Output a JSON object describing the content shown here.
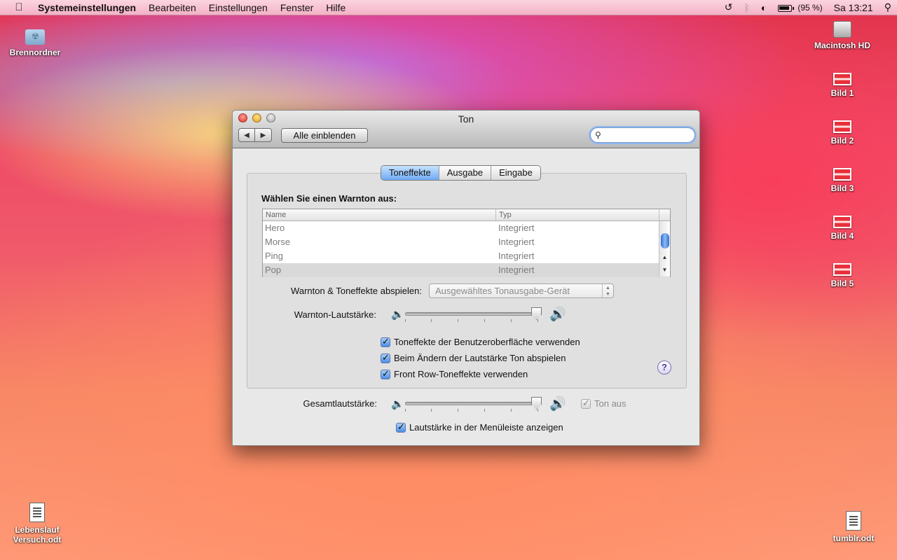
{
  "menubar": {
    "apple_icon": "apple-icon",
    "app_name": "Systemeinstellungen",
    "menus": [
      "Bearbeiten",
      "Einstellungen",
      "Fenster",
      "Hilfe"
    ],
    "battery_percent": "(95 %)",
    "clock": "Sa 13:21"
  },
  "desktop": {
    "icons": [
      {
        "label": "Brennordner",
        "icon": "burn-folder-icon"
      },
      {
        "label": "Macintosh HD",
        "icon": "hard-drive-icon"
      },
      {
        "label": "Bild 1",
        "icon": "image-file-icon"
      },
      {
        "label": "Bild 2",
        "icon": "image-file-icon"
      },
      {
        "label": "Bild 3",
        "icon": "image-file-icon"
      },
      {
        "label": "Bild 4",
        "icon": "image-file-icon"
      },
      {
        "label": "Bild 5",
        "icon": "image-file-icon"
      },
      {
        "label": "Lebenslauf\nVersuch.odt",
        "icon": "document-icon"
      },
      {
        "label": "tumblr.odt",
        "icon": "document-icon"
      }
    ]
  },
  "window": {
    "title": "Ton",
    "show_all_label": "Alle einblenden",
    "search_value": "",
    "tabs": [
      {
        "label": "Toneffekte",
        "active": true
      },
      {
        "label": "Ausgabe",
        "active": false
      },
      {
        "label": "Eingabe",
        "active": false
      }
    ],
    "choose_label": "Wählen Sie einen Warnton aus:",
    "table": {
      "columns": [
        "Name",
        "Typ"
      ],
      "rows": [
        {
          "name": "Hero",
          "type": "Integriert",
          "selected": false
        },
        {
          "name": "Morse",
          "type": "Integriert",
          "selected": false
        },
        {
          "name": "Ping",
          "type": "Integriert",
          "selected": false
        },
        {
          "name": "Pop",
          "type": "Integriert",
          "selected": true
        }
      ]
    },
    "play_through_label": "Warnton & Toneffekte abspielen:",
    "play_through_value": "Ausgewähltes Tonausgabe-Gerät",
    "alert_volume_label": "Warnton-Lautstärke:",
    "alert_volume_level": 0.98,
    "checkboxes": [
      {
        "label": "Toneffekte der Benutzeroberfläche verwenden",
        "checked": true
      },
      {
        "label": "Beim Ändern der Lautstärke Ton abspielen",
        "checked": true
      },
      {
        "label": "Front Row-Toneffekte verwenden",
        "checked": true
      }
    ],
    "help_label": "?",
    "output_volume_label": "Gesamtlautstärke:",
    "output_volume_level": 0.98,
    "mute_label": "Ton aus",
    "mute_checked": true,
    "menubar_volume_label": "Lautstärke in der Menüleiste anzeigen",
    "menubar_volume_checked": true
  }
}
